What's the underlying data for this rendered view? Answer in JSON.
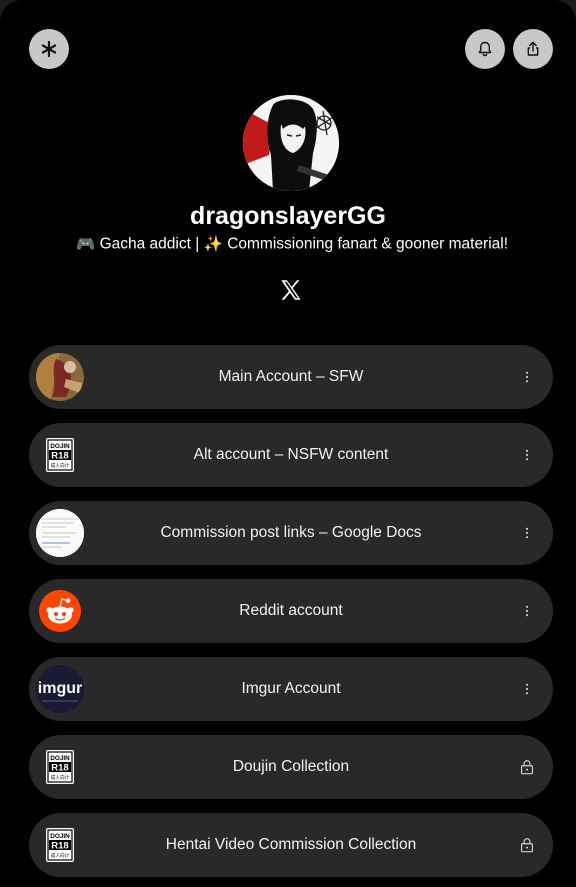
{
  "profile": {
    "username": "dragonslayerGG",
    "bio_emoji_1": "🎮",
    "bio_part_1": "Gacha addict |",
    "bio_emoji_2": "✨",
    "bio_part_2": "Commissioning fanart & gooner material!"
  },
  "top_buttons": {
    "left_icon": "asterisk-icon",
    "right_icons": [
      "bell-icon",
      "share-icon"
    ]
  },
  "social": {
    "icon": "x-logo-icon"
  },
  "links": [
    {
      "label": "Main Account – SFW",
      "thumb": "artwork",
      "action": "more"
    },
    {
      "label": "Alt account – NSFW content",
      "thumb": "doujin-r18",
      "action": "more"
    },
    {
      "label": "Commission post links – Google Docs",
      "thumb": "document",
      "action": "more"
    },
    {
      "label": "Reddit account",
      "thumb": "reddit",
      "action": "more"
    },
    {
      "label": "Imgur Account",
      "thumb": "imgur",
      "action": "more"
    },
    {
      "label": "Doujin Collection",
      "thumb": "doujin-r18",
      "action": "locked"
    },
    {
      "label": "Hentai Video Commission Collection",
      "thumb": "doujin-r18",
      "action": "locked"
    }
  ],
  "thumb_text": {
    "doujin": "DOJIN",
    "r18": "R18",
    "sub": "成人向け",
    "imgur": "imgur"
  },
  "colors": {
    "background": "#000000",
    "row": "#2a292a",
    "reddit": "#ff4500",
    "imgur_bg": "#1b1a33",
    "top_button": "#c8c8c8"
  }
}
